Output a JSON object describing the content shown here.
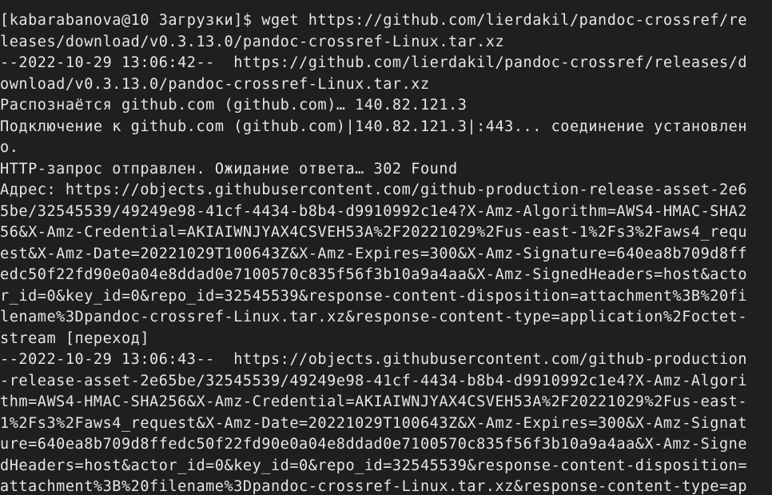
{
  "terminal": {
    "lines": [
      "[kabarabanova@10 Загрузки]$ wget https://github.com/lierdakil/pandoc-crossref/re",
      "leases/download/v0.3.13.0/pandoc-crossref-Linux.tar.xz",
      "--2022-10-29 13:06:42--  https://github.com/lierdakil/pandoc-crossref/releases/d",
      "ownload/v0.3.13.0/pandoc-crossref-Linux.tar.xz",
      "Распознаётся github.com (github.com)… 140.82.121.3",
      "Подключение к github.com (github.com)|140.82.121.3|:443... соединение установлен",
      "о.",
      "HTTP-запрос отправлен. Ожидание ответа… 302 Found",
      "Адрес: https://objects.githubusercontent.com/github-production-release-asset-2e6",
      "5be/32545539/49249e98-41cf-4434-b8b4-d9910992c1e4?X-Amz-Algorithm=AWS4-HMAC-SHA2",
      "56&X-Amz-Credential=AKIAIWNJYAX4CSVEH53A%2F20221029%2Fus-east-1%2Fs3%2Faws4_requ",
      "est&X-Amz-Date=20221029T100643Z&X-Amz-Expires=300&X-Amz-Signature=640ea8b709d8ff",
      "edc50f22fd90e0a04e8ddad0e7100570c835f56f3b10a9a4aa&X-Amz-SignedHeaders=host&acto",
      "r_id=0&key_id=0&repo_id=32545539&response-content-disposition=attachment%3B%20fi",
      "lename%3Dpandoc-crossref-Linux.tar.xz&response-content-type=application%2Foctet-",
      "stream [переход]",
      "--2022-10-29 13:06:43--  https://objects.githubusercontent.com/github-production",
      "-release-asset-2e65be/32545539/49249e98-41cf-4434-b8b4-d9910992c1e4?X-Amz-Algori",
      "thm=AWS4-HMAC-SHA256&X-Amz-Credential=AKIAIWNJYAX4CSVEH53A%2F20221029%2Fus-east-",
      "1%2Fs3%2Faws4_request&X-Amz-Date=20221029T100643Z&X-Amz-Expires=300&X-Amz-Signat",
      "ure=640ea8b709d8ffedc50f22fd90e0a04e8ddad0e7100570c835f56f3b10a9a4aa&X-Amz-Signe",
      "dHeaders=host&actor_id=0&key_id=0&repo_id=32545539&response-content-disposition=",
      "attachment%3B%20filename%3Dpandoc-crossref-Linux.tar.xz&response-content-type=ap"
    ]
  },
  "colors": {
    "background": "#1f1f1f",
    "foreground": "#e6e6e6"
  }
}
